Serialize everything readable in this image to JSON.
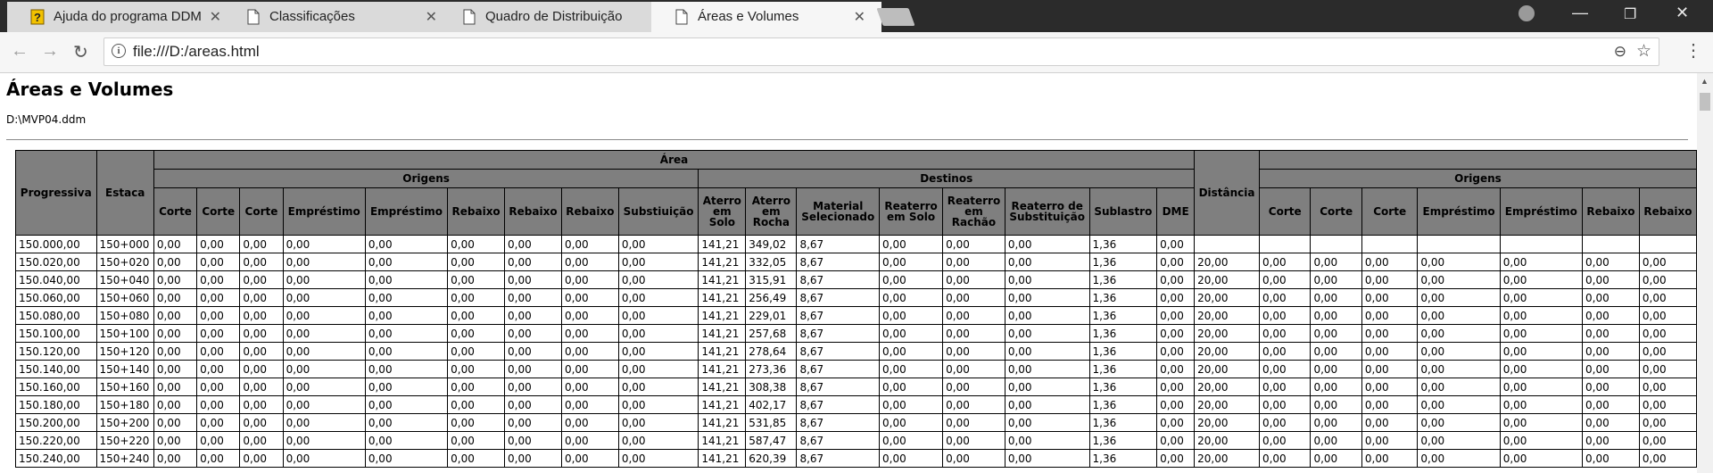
{
  "browser": {
    "tabs": [
      {
        "title": "Ajuda do programa DDM",
        "icon": "help-page-icon",
        "active": false
      },
      {
        "title": "Classificações",
        "icon": "page-icon",
        "active": false
      },
      {
        "title": "Quadro de Distribuição",
        "icon": "page-icon",
        "active": false
      },
      {
        "title": "Áreas e Volumes",
        "icon": "page-icon",
        "active": true
      }
    ],
    "address": "file:///D:/areas.html"
  },
  "page": {
    "title": "Áreas e Volumes",
    "file_path": "D:\\MVP04.ddm"
  },
  "table": {
    "headers": {
      "progressiva": "Progressiva",
      "estaca": "Estaca",
      "area": "Área",
      "origens": "Origens",
      "destinos": "Destinos",
      "distancia": "Distância",
      "origem_cols": [
        "Corte",
        "Corte",
        "Corte",
        "Empréstimo",
        "Empréstimo",
        "Rebaixo",
        "Rebaixo",
        "Rebaixo",
        "Substiuição"
      ],
      "destino_cols": [
        "Aterro em Solo",
        "Aterro em Rocha",
        "Material Selecionado",
        "Reaterro em Solo",
        "Reaterro em Rachão",
        "Reaterro de Substituição",
        "Sublastro",
        "DME"
      ],
      "right_origem_cols": [
        "Corte",
        "Corte",
        "Corte",
        "Empréstimo",
        "Empréstimo",
        "Rebaixo",
        "Rebaixo"
      ]
    },
    "rows": [
      [
        "150.000,00",
        "150+000",
        "0,00",
        "0,00",
        "0,00",
        "0,00",
        "0,00",
        "0,00",
        "0,00",
        "0,00",
        "0,00",
        "141,21",
        "349,02",
        "8,67",
        "0,00",
        "0,00",
        "0,00",
        "1,36",
        "0,00",
        "",
        "",
        "",
        "",
        "",
        "",
        "",
        ""
      ],
      [
        "150.020,00",
        "150+020",
        "0,00",
        "0,00",
        "0,00",
        "0,00",
        "0,00",
        "0,00",
        "0,00",
        "0,00",
        "0,00",
        "141,21",
        "332,05",
        "8,67",
        "0,00",
        "0,00",
        "0,00",
        "1,36",
        "0,00",
        "20,00",
        "0,00",
        "0,00",
        "0,00",
        "0,00",
        "0,00",
        "0,00",
        "0,00"
      ],
      [
        "150.040,00",
        "150+040",
        "0,00",
        "0,00",
        "0,00",
        "0,00",
        "0,00",
        "0,00",
        "0,00",
        "0,00",
        "0,00",
        "141,21",
        "315,91",
        "8,67",
        "0,00",
        "0,00",
        "0,00",
        "1,36",
        "0,00",
        "20,00",
        "0,00",
        "0,00",
        "0,00",
        "0,00",
        "0,00",
        "0,00",
        "0,00"
      ],
      [
        "150.060,00",
        "150+060",
        "0,00",
        "0,00",
        "0,00",
        "0,00",
        "0,00",
        "0,00",
        "0,00",
        "0,00",
        "0,00",
        "141,21",
        "256,49",
        "8,67",
        "0,00",
        "0,00",
        "0,00",
        "1,36",
        "0,00",
        "20,00",
        "0,00",
        "0,00",
        "0,00",
        "0,00",
        "0,00",
        "0,00",
        "0,00"
      ],
      [
        "150.080,00",
        "150+080",
        "0,00",
        "0,00",
        "0,00",
        "0,00",
        "0,00",
        "0,00",
        "0,00",
        "0,00",
        "0,00",
        "141,21",
        "229,01",
        "8,67",
        "0,00",
        "0,00",
        "0,00",
        "1,36",
        "0,00",
        "20,00",
        "0,00",
        "0,00",
        "0,00",
        "0,00",
        "0,00",
        "0,00",
        "0,00"
      ],
      [
        "150.100,00",
        "150+100",
        "0,00",
        "0,00",
        "0,00",
        "0,00",
        "0,00",
        "0,00",
        "0,00",
        "0,00",
        "0,00",
        "141,21",
        "257,68",
        "8,67",
        "0,00",
        "0,00",
        "0,00",
        "1,36",
        "0,00",
        "20,00",
        "0,00",
        "0,00",
        "0,00",
        "0,00",
        "0,00",
        "0,00",
        "0,00"
      ],
      [
        "150.120,00",
        "150+120",
        "0,00",
        "0,00",
        "0,00",
        "0,00",
        "0,00",
        "0,00",
        "0,00",
        "0,00",
        "0,00",
        "141,21",
        "278,64",
        "8,67",
        "0,00",
        "0,00",
        "0,00",
        "1,36",
        "0,00",
        "20,00",
        "0,00",
        "0,00",
        "0,00",
        "0,00",
        "0,00",
        "0,00",
        "0,00"
      ],
      [
        "150.140,00",
        "150+140",
        "0,00",
        "0,00",
        "0,00",
        "0,00",
        "0,00",
        "0,00",
        "0,00",
        "0,00",
        "0,00",
        "141,21",
        "273,36",
        "8,67",
        "0,00",
        "0,00",
        "0,00",
        "1,36",
        "0,00",
        "20,00",
        "0,00",
        "0,00",
        "0,00",
        "0,00",
        "0,00",
        "0,00",
        "0,00"
      ],
      [
        "150.160,00",
        "150+160",
        "0,00",
        "0,00",
        "0,00",
        "0,00",
        "0,00",
        "0,00",
        "0,00",
        "0,00",
        "0,00",
        "141,21",
        "308,38",
        "8,67",
        "0,00",
        "0,00",
        "0,00",
        "1,36",
        "0,00",
        "20,00",
        "0,00",
        "0,00",
        "0,00",
        "0,00",
        "0,00",
        "0,00",
        "0,00"
      ],
      [
        "150.180,00",
        "150+180",
        "0,00",
        "0,00",
        "0,00",
        "0,00",
        "0,00",
        "0,00",
        "0,00",
        "0,00",
        "0,00",
        "141,21",
        "402,17",
        "8,67",
        "0,00",
        "0,00",
        "0,00",
        "1,36",
        "0,00",
        "20,00",
        "0,00",
        "0,00",
        "0,00",
        "0,00",
        "0,00",
        "0,00",
        "0,00"
      ],
      [
        "150.200,00",
        "150+200",
        "0,00",
        "0,00",
        "0,00",
        "0,00",
        "0,00",
        "0,00",
        "0,00",
        "0,00",
        "0,00",
        "141,21",
        "531,85",
        "8,67",
        "0,00",
        "0,00",
        "0,00",
        "1,36",
        "0,00",
        "20,00",
        "0,00",
        "0,00",
        "0,00",
        "0,00",
        "0,00",
        "0,00",
        "0,00"
      ],
      [
        "150.220,00",
        "150+220",
        "0,00",
        "0,00",
        "0,00",
        "0,00",
        "0,00",
        "0,00",
        "0,00",
        "0,00",
        "0,00",
        "141,21",
        "587,47",
        "8,67",
        "0,00",
        "0,00",
        "0,00",
        "1,36",
        "0,00",
        "20,00",
        "0,00",
        "0,00",
        "0,00",
        "0,00",
        "0,00",
        "0,00",
        "0,00"
      ],
      [
        "150.240,00",
        "150+240",
        "0,00",
        "0,00",
        "0,00",
        "0,00",
        "0,00",
        "0,00",
        "0,00",
        "0,00",
        "0,00",
        "141,21",
        "620,39",
        "8,67",
        "0,00",
        "0,00",
        "0,00",
        "1,36",
        "0,00",
        "20,00",
        "0,00",
        "0,00",
        "0,00",
        "0,00",
        "0,00",
        "0,00",
        "0,00"
      ]
    ]
  }
}
